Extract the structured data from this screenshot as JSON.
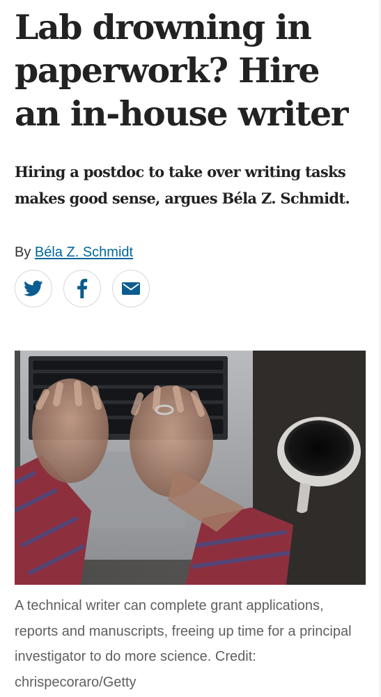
{
  "article": {
    "headline": "Lab drowning in paperwork? Hire an in-house writer",
    "standfirst": "Hiring a postdoc to take over writing tasks makes good sense, argues Béla Z. Schmidt.",
    "byline_prefix": "By",
    "author_name": "Béla Z. Schmidt",
    "caption": "A technical writer can complete grant applications, reports and manuscripts, freeing up time for a principal investigator to do more science.   Credit: chrispecoraro/Getty"
  },
  "share": {
    "buttons": [
      {
        "icon": "twitter-icon",
        "label": "Twitter"
      },
      {
        "icon": "facebook-icon",
        "label": "Facebook"
      },
      {
        "icon": "email-icon",
        "label": "Email"
      }
    ]
  },
  "colors": {
    "link": "#006699",
    "brand_blue": "#0b5c8f",
    "text": "#222222",
    "caption_text": "#5f5f5f"
  }
}
